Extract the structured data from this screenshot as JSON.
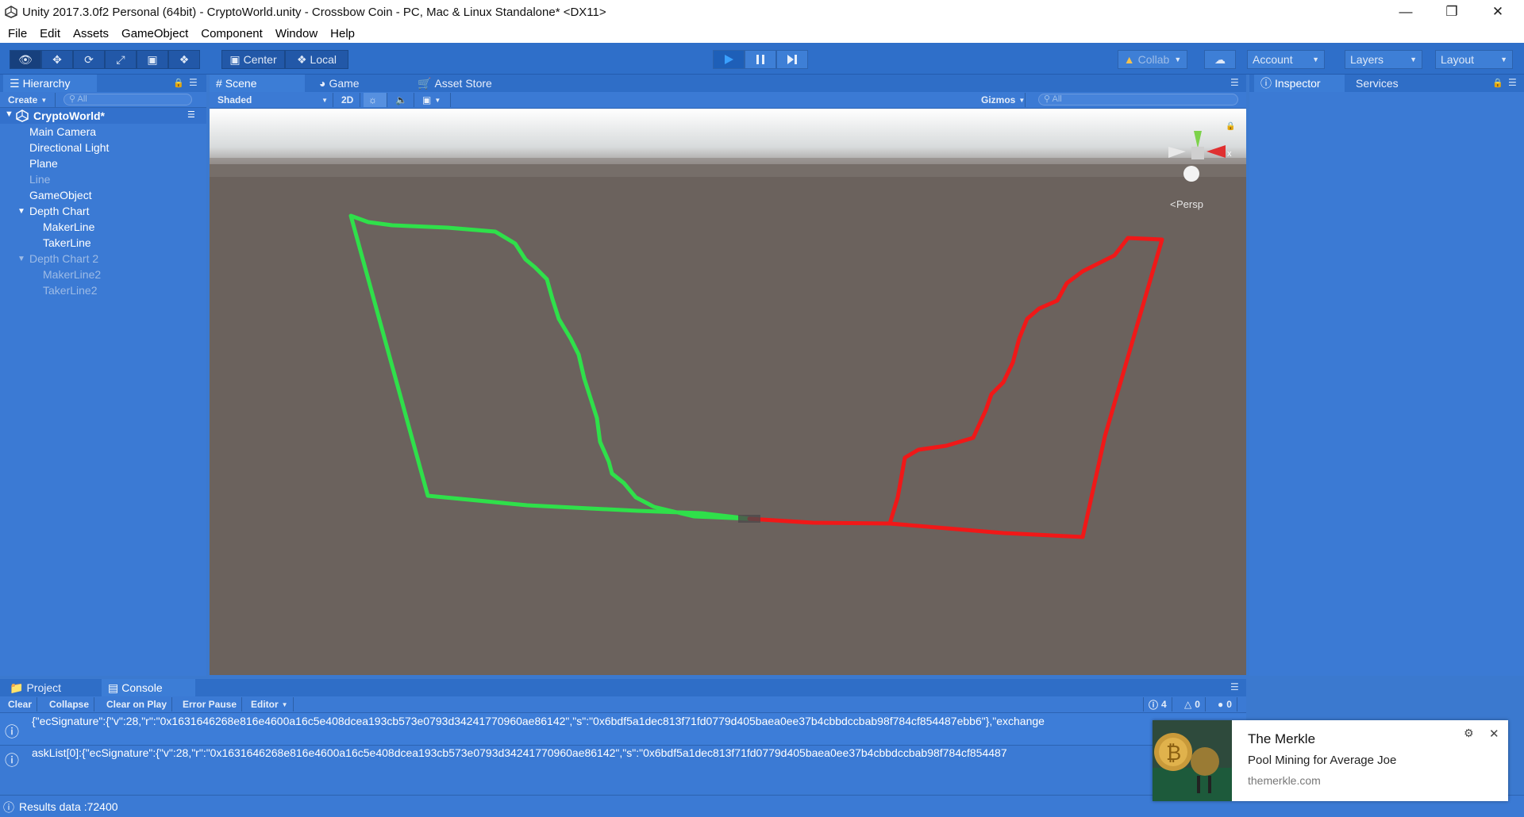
{
  "window": {
    "title": "Unity 2017.3.0f2 Personal (64bit) - CryptoWorld.unity - Crossbow Coin - PC, Mac & Linux Standalone* <DX11>"
  },
  "menu": [
    "File",
    "Edit",
    "Assets",
    "GameObject",
    "Component",
    "Window",
    "Help"
  ],
  "toolbar": {
    "center": "Center",
    "local": "Local",
    "collab": "Collab",
    "account": "Account",
    "layers": "Layers",
    "layout": "Layout"
  },
  "hierarchy": {
    "tab": "Hierarchy",
    "create": "Create",
    "search_placeholder": "All",
    "scene": "CryptoWorld*",
    "items": [
      "Main Camera",
      "Directional Light",
      "Plane",
      "Line",
      "GameObject",
      "Depth Chart",
      "MakerLine",
      "TakerLine",
      "Depth Chart 2",
      "MakerLine2",
      "TakerLine2"
    ]
  },
  "scene": {
    "tabs": [
      "Scene",
      "Game",
      "Asset Store"
    ],
    "shading": "Shaded",
    "mode2d": "2D",
    "gizmos": "Gizmos",
    "search_placeholder": "All",
    "persp": "Persp",
    "axis_x": "x",
    "colors": {
      "maker": "#2fe04a",
      "taker": "#f01818"
    }
  },
  "inspector": {
    "tabs": [
      "Inspector",
      "Services"
    ]
  },
  "console": {
    "tabs": [
      "Project",
      "Console"
    ],
    "buttons": [
      "Clear",
      "Collapse",
      "Clear on Play",
      "Error Pause",
      "Editor"
    ],
    "counts": {
      "info": "4",
      "warn": "0",
      "error": "0"
    },
    "lines": [
      "{\"ecSignature\":{\"v\":28,\"r\":\"0x1631646268e816e4600a16c5e408dcea193cb573e0793d34241770960ae86142\",\"s\":\"0x6bdf5a1dec813f71fd0779d405baea0ee37b4cbbdccbab98f784cf854487ebb6\"},\"exchange",
      "askList[0]:{\"ecSignature\":{\"v\":28,\"r\":\"0x1631646268e816e4600a16c5e408dcea193cb573e0793d34241770960ae86142\",\"s\":\"0x6bdf5a1dec813f71fd0779d405baea0ee37b4cbbdccbab98f784cf854487"
    ],
    "status": "Results data :72400"
  },
  "notification": {
    "title": "The Merkle",
    "body": "Pool Mining for Average Joe",
    "source": "themerkle.com"
  }
}
